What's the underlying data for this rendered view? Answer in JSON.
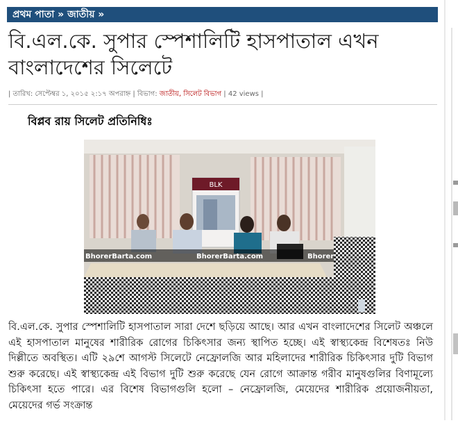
{
  "breadcrumb": {
    "home": "প্রথম পাতা",
    "sep1": " » ",
    "category": "জাতীয়",
    "sep2": " »"
  },
  "article": {
    "title": "বি.এল.কে. সুপার স্পেশালিটি হাসপাতাল এখন বাংলাদেশের সিলেটে",
    "meta_date_label": "| তারিখ: ",
    "meta_date": "সেপ্টেম্বর ১, ২০১৫ ২:১৭ অপরাহ্ন",
    "meta_section_label": " | বিভাগ: ",
    "meta_section": "জাতীয়, সিলেট বিভাগ",
    "meta_views": " | 42 views |",
    "byline": "বিপ্লব রায় সিলেট প্রতিনিধিঃ",
    "photo": {
      "banner_brand": "BLK",
      "watermark_1": "BhorerBarta.com",
      "watermark_2": "BhorerBarta.com",
      "watermark_3": "BhorerBarta.com"
    },
    "body": "বি.এল.কে. সুপার স্পেশালিটি হাসপাতাল সারা দেশে ছড়িয়ে আছে। আর এখন বাংলাদেশের সিলেট অঞ্চলে এই হাসপাতাল মানুষের শারীরিক রোগের চিকিৎসার জন্য স্থাপিত হচ্ছে। এই স্বাস্থ্যকেন্দ্র বিশেষতঃ নিউ দিল্লীতে অবস্থিত। এটি ২৯শে আগস্ট সিলেটে নেফ্রোলজি আর মহিলাদের শারীরিক চিকিৎসার দুটি বিভাগ শুরু করেছে। এই স্বাস্থ্যকেন্দ্র এই বিভাগ দুটি শুরু করেছে যেন রোগে আক্রান্ত গরীব মানুষগুলির বিণামূল্যে চিকিৎসা হতে পারে। এর বিশেষ বিভাগগুলি হলো – নেফ্রোলজি, মেয়েদের শারীরিক প্রয়োজনীয়তা, মেয়েদের গর্ভ সংক্রান্ত"
  },
  "colors": {
    "breadcrumb_bg": "#1f4f7c",
    "meta_highlight": "#b30000"
  }
}
